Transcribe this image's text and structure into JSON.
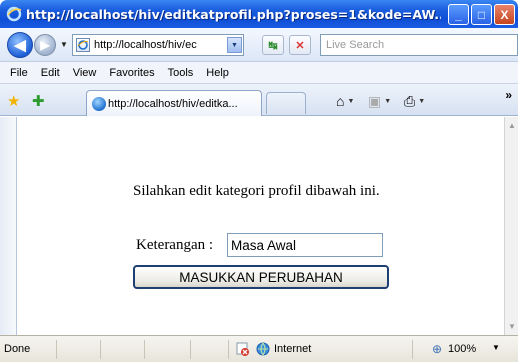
{
  "window": {
    "title": "http://localhost/hiv/editkatprofil.php?proses=1&kode=AW...",
    "minimize_label": "_",
    "maximize_label": "□",
    "close_label": "X"
  },
  "address_bar": {
    "url": "http://localhost/hiv/ec",
    "search_placeholder": "Live Search"
  },
  "menu": {
    "items": [
      "File",
      "Edit",
      "View",
      "Favorites",
      "Tools",
      "Help"
    ]
  },
  "tabs": {
    "active_label": "http://localhost/hiv/editka..."
  },
  "page": {
    "prompt": "Silahkan edit kategori profil dibawah ini.",
    "field_label": "Keterangan :",
    "field_value": "Masa Awal",
    "submit_label": "MASUKKAN PERUBAHAN"
  },
  "status": {
    "text": "Done",
    "zone": "Internet",
    "zoom": "100%"
  }
}
